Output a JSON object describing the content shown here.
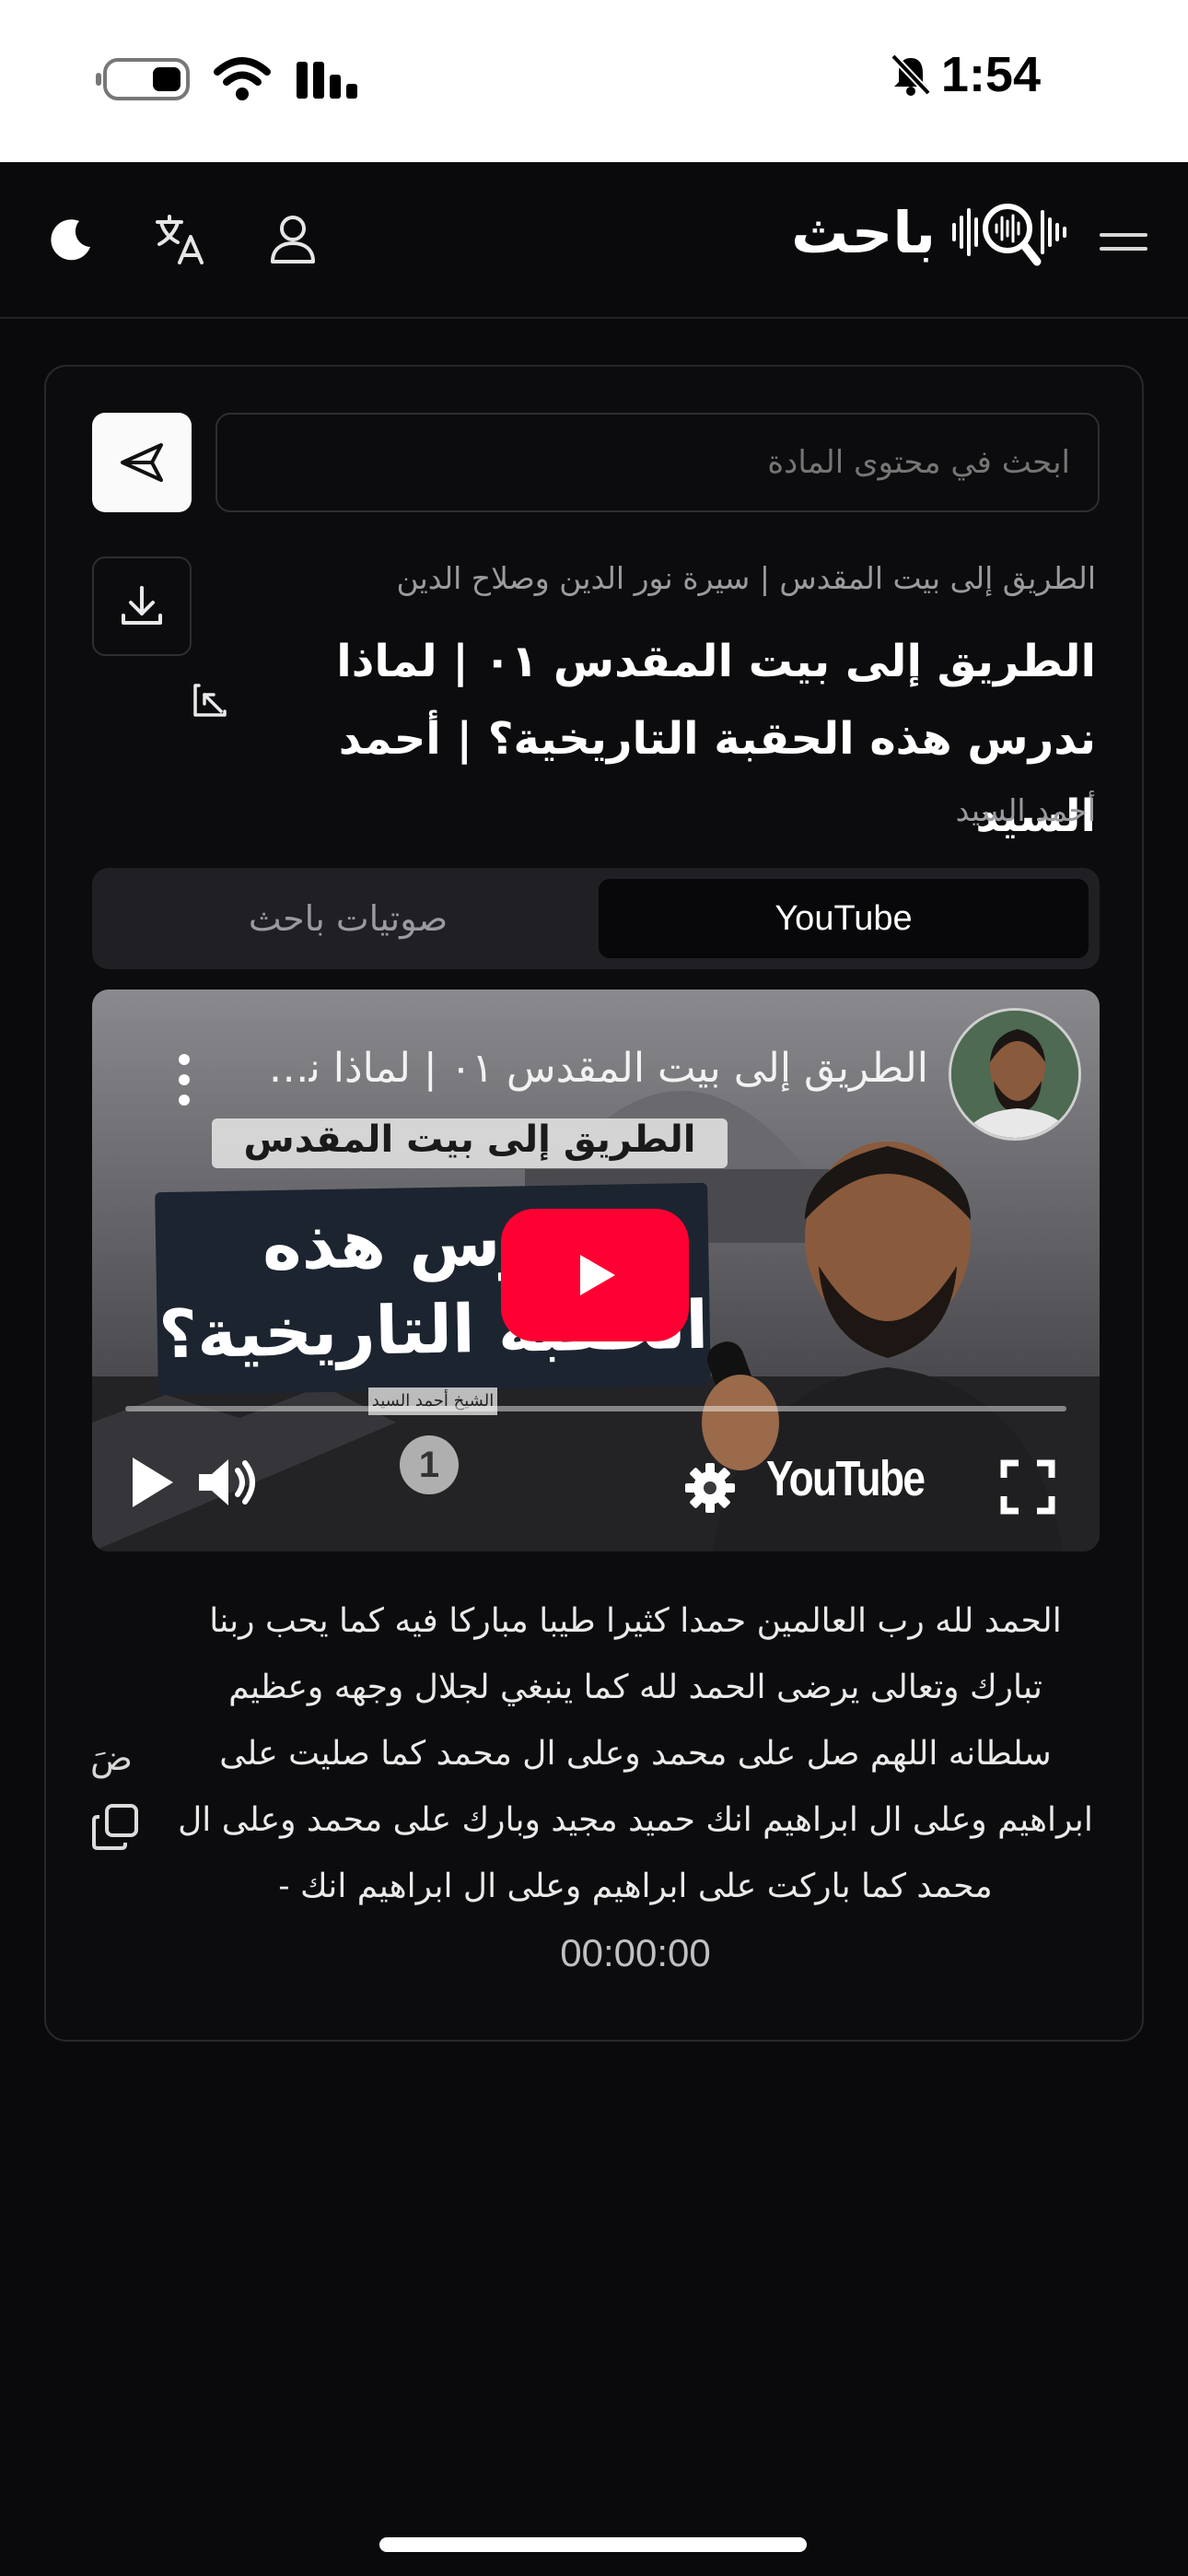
{
  "status_bar": {
    "time": "1:54",
    "icons": [
      "battery-icon",
      "wifi-icon",
      "signal-icon",
      "bell-muted-icon"
    ]
  },
  "header": {
    "brand_name": "باحث",
    "icons": [
      "moon-icon",
      "translate-icon",
      "user-icon",
      "brand-logo-icon",
      "menu-icon"
    ]
  },
  "search": {
    "placeholder": "ابحث في محتوى المادة",
    "value": ""
  },
  "content": {
    "series": "الطريق إلى بيت المقدس | سيرة نور الدين وصلاح الدين",
    "title": "الطريق إلى بيت المقدس ٠١ | لماذا ندرس هذه الحقبة التاريخية؟ | أحمد السيد",
    "author": "أحمد السيد"
  },
  "tabs": [
    {
      "label": "YouTube",
      "active": true
    },
    {
      "label": "صوتيات باحث",
      "active": false
    }
  ],
  "video": {
    "title": "الطريق إلى بيت المقدس ٠١ | لماذا ندر...",
    "thumbnail_banner": "الطريق إلى بيت المقدس",
    "thumbnail_line1": "ندرس هذه",
    "thumbnail_line2": "الحقبة التاريخية؟",
    "thumbnail_caption": "الشيخ أحمد السيد",
    "badge": "1",
    "brand": "YouTube",
    "play_color": "#ff0033"
  },
  "transcript": {
    "text": "الحمد لله رب العالمين حمدا كثيرا طيبا مباركا فيه كما يحب ربنا تبارك وتعالى يرضى الحمد لله كما ينبغي لجلال وجهه وعظيم سلطانه اللهم صل على محمد وعلى ال محمد كما صليت على ابراهيم وعلى ال ابراهيم انك حميد مجيد وبارك على محمد وعلى ال محمد كما باركت على ابراهيم وعلى ال ابراهيم انك -",
    "timestamp": "00:00:00",
    "side_label": "ضَ"
  }
}
